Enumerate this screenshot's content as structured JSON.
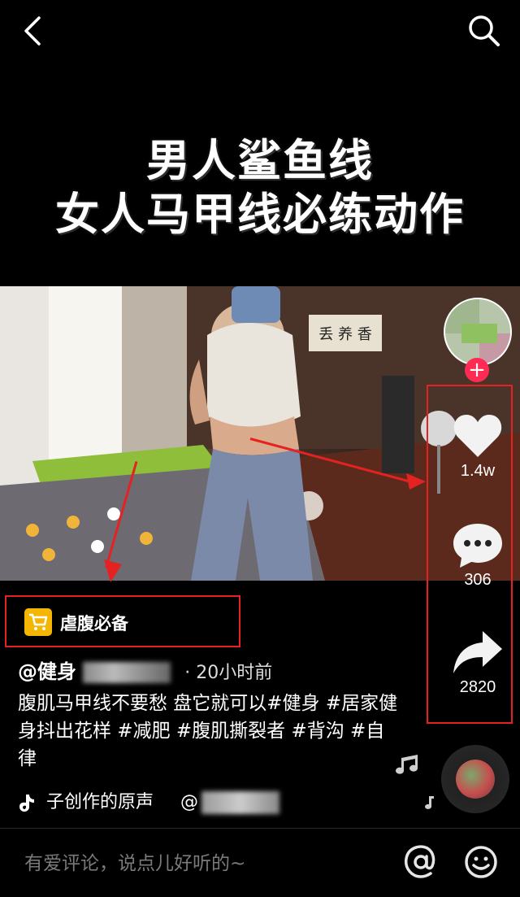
{
  "header": {
    "back_icon": "chevron-left-icon",
    "search_icon": "search-icon"
  },
  "video": {
    "title_line1": "男人鲨鱼线",
    "title_line2": "女人马甲线必练动作",
    "wall_sign": "丢 养 香"
  },
  "actions": {
    "like_count": "1.4w",
    "comment_count": "306",
    "share_count": "2820",
    "follow_symbol": "+"
  },
  "shop": {
    "label": "虐腹必备",
    "icon": "shopping-cart-icon"
  },
  "post": {
    "author": "@健身",
    "time": "· 20小时前",
    "description": "腹肌马甲线不要愁 盘它就可以#健身 #居家健身抖出花样 #减肥 #腹肌撕裂者 #背沟 #自律",
    "music": "子创作的原声",
    "music_at": "@",
    "music_icon": "tiktok-note-icon"
  },
  "comment_bar": {
    "placeholder": "有爱评论，说点儿好听的~",
    "at_icon": "at-icon",
    "emoji_icon": "emoji-icon"
  },
  "colors": {
    "annotation": "#e52222",
    "follow_button": "#fe2c55",
    "cart_badge": "#f4b600"
  }
}
